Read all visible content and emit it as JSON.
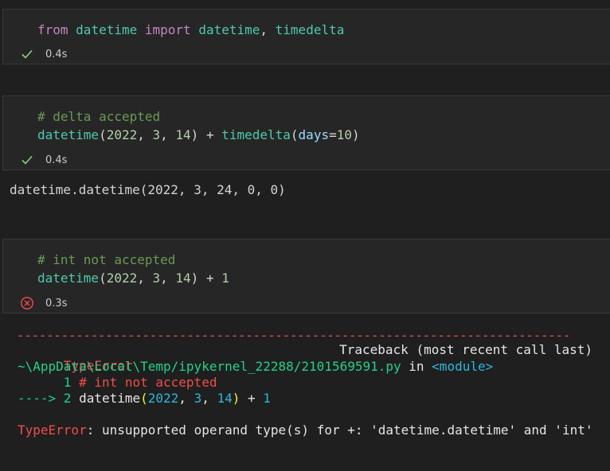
{
  "cells": [
    {
      "line1": {
        "kw_from": "from",
        "mod": "datetime",
        "kw_import": "import",
        "name1": "datetime",
        "comma": ",",
        "name2": "timedelta"
      },
      "status": {
        "icon": "check-icon",
        "time": "0.4s"
      }
    },
    {
      "comment": "# delta accepted",
      "line2": {
        "fn": "datetime",
        "open": "(",
        "n1": "2022",
        "sep1": ", ",
        "n2": "3",
        "sep2": ", ",
        "n3": "14",
        "close_plus": ") + ",
        "fn2": "timedelta",
        "open2": "(",
        "param": "days",
        "eq": "=",
        "n4": "10",
        "close2": ")"
      },
      "status": {
        "icon": "check-icon",
        "time": "0.4s"
      },
      "output": "datetime.datetime(2022, 3, 24, 0, 0)"
    },
    {
      "comment": "# int not accepted",
      "line2": {
        "fn": "datetime",
        "open": "(",
        "n1": "2022",
        "sep1": ", ",
        "n2": "3",
        "sep2": ", ",
        "n3": "14",
        "close_plus": ") + ",
        "n4": "1"
      },
      "status": {
        "icon": "error-circle-icon",
        "time": "0.3s"
      }
    }
  ],
  "traceback": {
    "dashes": "---------------------------------------------------------------------------",
    "error_type": "TypeError",
    "header_right": "Traceback (most recent call last)",
    "path": "~\\AppData\\Local\\Temp/ipykernel_22288/2101569591.py",
    "in_text": " in ",
    "module": "<module>",
    "line1_prefix": "      1 ",
    "line1_code": "# int not accepted",
    "arrow": "----> 2 ",
    "fn": "datetime",
    "open": "(",
    "n1": "2022",
    "sep1": ", ",
    "n2": "3",
    "sep2": ", ",
    "n3": "14",
    "close": ")",
    "plus": " + ",
    "n4": "1",
    "final_type": "TypeError",
    "final_msg": ": unsupported operand type(s) for +: 'datetime.datetime' and 'int'"
  },
  "colors": {
    "background": "#1f1f1f",
    "cell": "#262626",
    "success": "#89d185",
    "error": "#f14c4c"
  }
}
